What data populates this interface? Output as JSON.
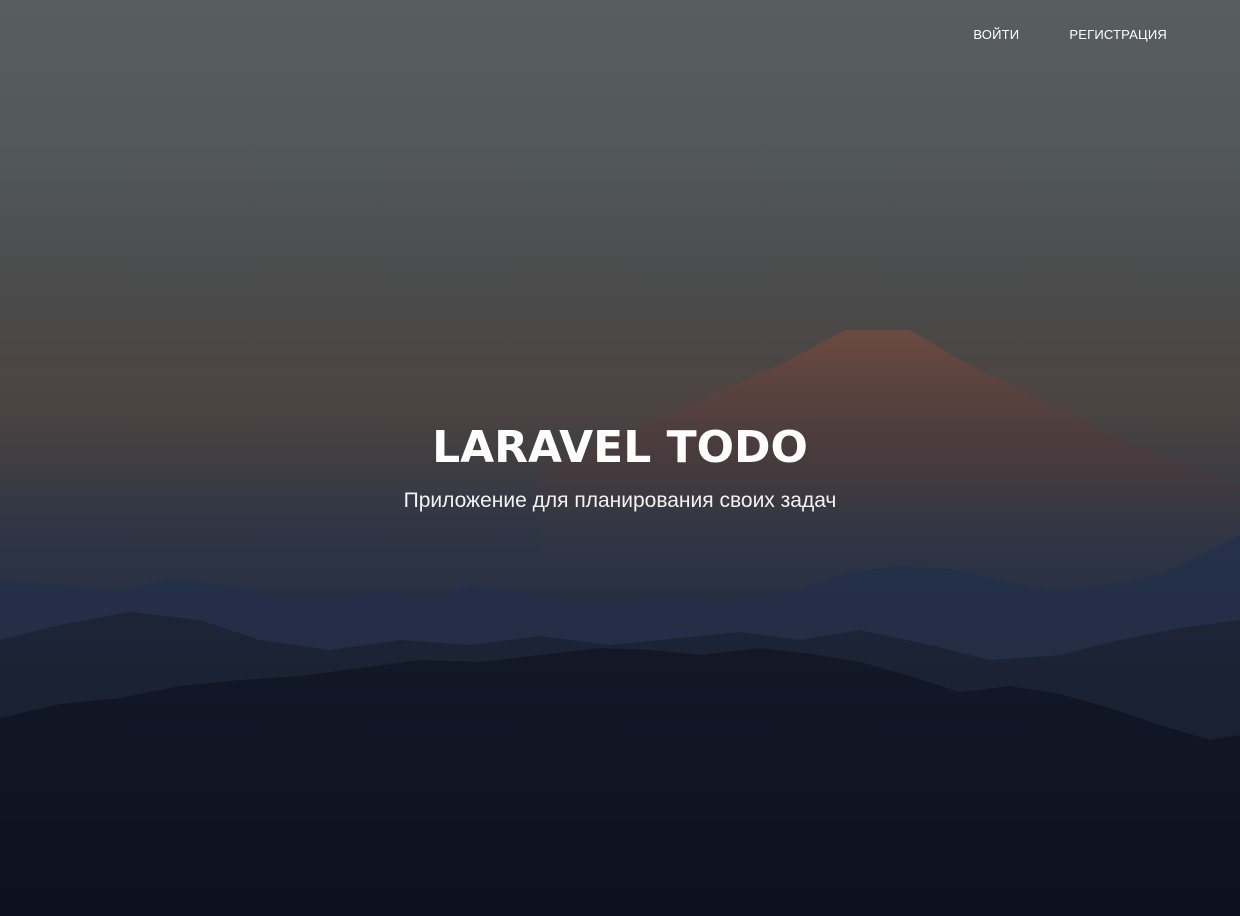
{
  "nav": {
    "login_label": "ВОЙТИ",
    "register_label": "РЕГИСТРАЦИЯ"
  },
  "hero": {
    "title": "LARAVEL TODO",
    "subtitle": "Приложение для планирования своих задач"
  },
  "colors": {
    "text": "#ffffff",
    "sky_top": "#585e60",
    "mountain_peak": "#6a4a40",
    "foreground": "#101423"
  }
}
